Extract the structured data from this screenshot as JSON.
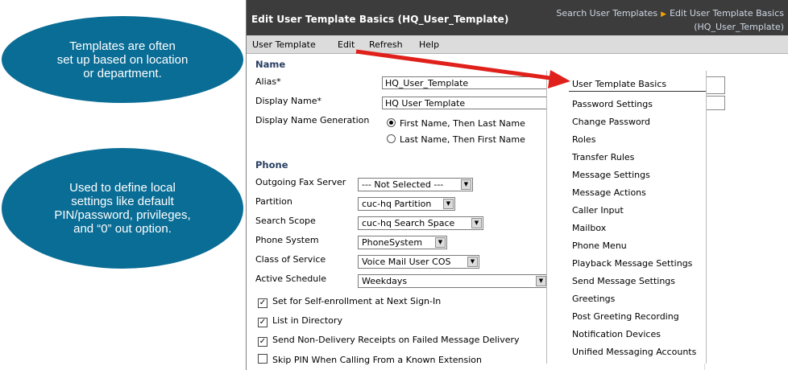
{
  "callouts": [
    "Templates are often\nset up based on location\nor department.",
    "Used to define local\nsettings like default\nPIN/password, privileges,\nand “0” out option."
  ],
  "window": {
    "title": "Edit User Template Basics  (HQ_User_Template)",
    "breadcrumb": [
      "Search User Templates",
      "Edit User Template Basics",
      "(HQ_User_Template)"
    ]
  },
  "menu": [
    "User Template",
    "Edit",
    "Refresh",
    "Help"
  ],
  "name_section": {
    "heading": "Name",
    "alias_label": "Alias*",
    "alias_value": "HQ_User_Template",
    "display_name_label": "Display Name*",
    "display_name_value": "HQ User Template",
    "generation_label": "Display Name Generation",
    "generation_options": [
      "First Name, Then Last Name",
      "Last Name, Then First Name"
    ],
    "generation_selected": 0
  },
  "phone_section": {
    "heading": "Phone",
    "fields": [
      {
        "label": "Outgoing Fax Server",
        "value": "--- Not Selected ---"
      },
      {
        "label": "Partition",
        "value": "cuc-hq Partition"
      },
      {
        "label": "Search Scope",
        "value": "cuc-hq Search Space"
      },
      {
        "label": "Phone System",
        "value": "PhoneSystem"
      },
      {
        "label": "Class of Service",
        "value": "Voice Mail User COS"
      },
      {
        "label": "Active Schedule",
        "value": "Weekdays"
      }
    ],
    "checkboxes": [
      {
        "label": "Set for Self-enrollment at Next Sign-In",
        "checked": true
      },
      {
        "label": "List in Directory",
        "checked": true
      },
      {
        "label": "Send Non-Delivery Receipts on Failed Message Delivery",
        "checked": true
      },
      {
        "label": "Skip PIN When Calling From a Known Extension",
        "checked": false
      }
    ]
  },
  "edit_menu": [
    "User Template Basics",
    "Password Settings",
    "Change Password",
    "Roles",
    "Transfer Rules",
    "Message Settings",
    "Message Actions",
    "Caller Input",
    "Mailbox",
    "Phone Menu",
    "Playback Message Settings",
    "Send Message Settings",
    "Greetings",
    "Post Greeting Recording",
    "Notification Devices",
    "Unified Messaging Accounts"
  ],
  "colors": {
    "callout": "#0a6d95",
    "arrow": "#e0201b",
    "titlebar": "#3c3c3c"
  }
}
